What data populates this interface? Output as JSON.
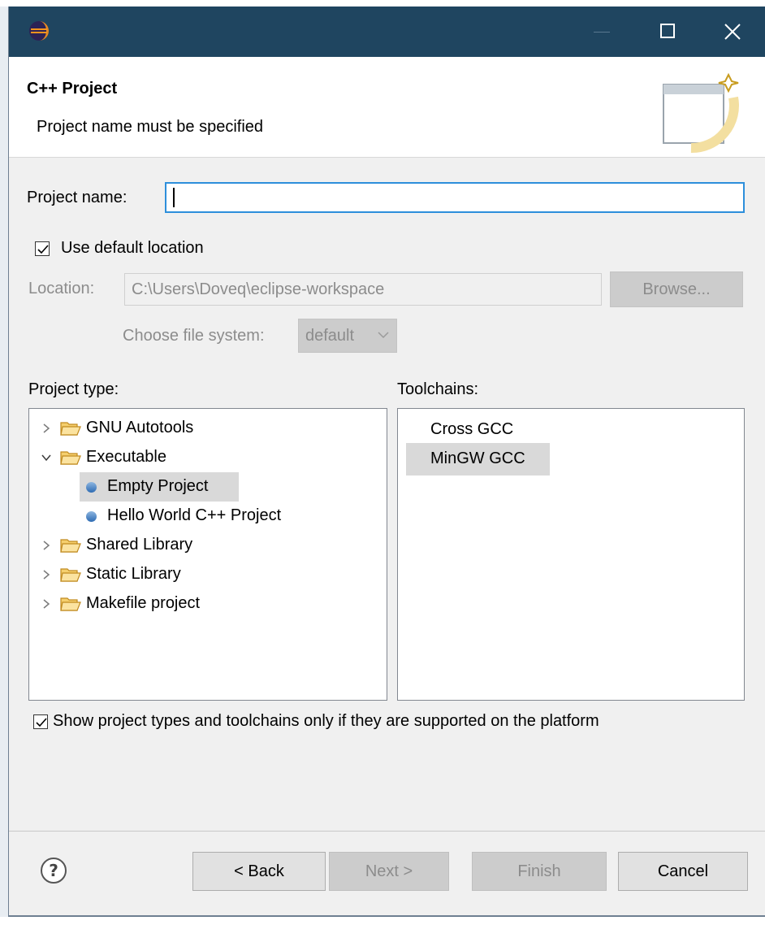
{
  "titlebar": {
    "icons": {
      "app": "eclipse-icon",
      "minimize": "minimize-icon",
      "maximize": "maximize-icon",
      "close": "close-icon"
    }
  },
  "header": {
    "title": "C++ Project",
    "message": "Project name must be specified"
  },
  "form": {
    "project_name_label": "Project name:",
    "project_name_value": "",
    "use_default_location_label": "Use default location",
    "use_default_location_checked": true,
    "location_label": "Location:",
    "location_value": "C:\\Users\\Doveq\\eclipse-workspace",
    "browse_label": "Browse...",
    "file_system_label": "Choose file system:",
    "file_system_value": "default"
  },
  "project_type": {
    "label": "Project type:",
    "items": [
      {
        "label": "GNU Autotools",
        "kind": "folder",
        "expanded": false
      },
      {
        "label": "Executable",
        "kind": "folder",
        "expanded": true
      },
      {
        "label": "Empty Project",
        "kind": "leaf",
        "selected": true
      },
      {
        "label": "Hello World C++ Project",
        "kind": "leaf",
        "selected": false
      },
      {
        "label": "Shared Library",
        "kind": "folder",
        "expanded": false
      },
      {
        "label": "Static Library",
        "kind": "folder",
        "expanded": false
      },
      {
        "label": "Makefile project",
        "kind": "folder",
        "expanded": false
      }
    ]
  },
  "toolchains": {
    "label": "Toolchains:",
    "items": [
      {
        "label": "Cross GCC",
        "selected": false
      },
      {
        "label": "MinGW GCC",
        "selected": true
      }
    ]
  },
  "filter": {
    "label": "Show project types and toolchains only if they are supported on the platform",
    "checked": true
  },
  "buttons": {
    "back": "< Back",
    "next": "Next >",
    "finish": "Finish",
    "cancel": "Cancel"
  },
  "colors": {
    "titlebar": "#1f4560",
    "focus_border": "#2d8fdb",
    "selection": "#d9d9d9"
  }
}
